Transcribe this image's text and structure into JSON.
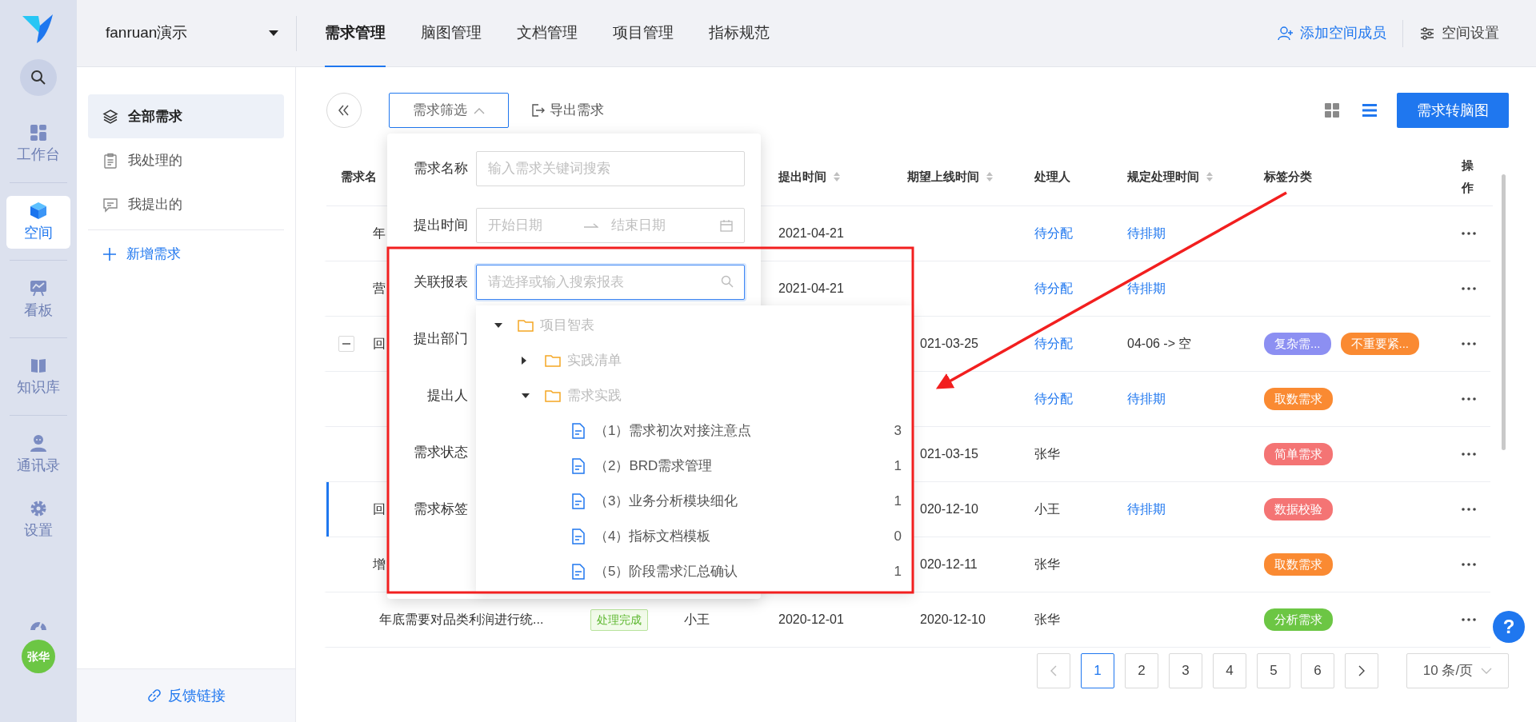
{
  "rail": {
    "groups": [
      [
        {
          "label": "工作台",
          "selected": false
        }
      ],
      [
        {
          "label": "空间",
          "selected": true
        }
      ],
      [
        {
          "label": "看板",
          "selected": false
        }
      ],
      [
        {
          "label": "知识库",
          "selected": false
        }
      ],
      [
        {
          "label": "通讯录",
          "selected": false
        },
        {
          "label": "设置",
          "selected": false
        }
      ]
    ],
    "avatar": "张华"
  },
  "workspace": {
    "name": "fanruan演示"
  },
  "tabs": [
    {
      "label": "需求管理",
      "selected": true
    },
    {
      "label": "脑图管理",
      "selected": false
    },
    {
      "label": "文档管理",
      "selected": false
    },
    {
      "label": "项目管理",
      "selected": false
    },
    {
      "label": "指标规范",
      "selected": false
    }
  ],
  "header_actions": [
    {
      "label": "添加空间成员",
      "primary": true
    },
    {
      "label": "空间设置",
      "primary": false
    }
  ],
  "nav": {
    "items": [
      {
        "label": "全部需求",
        "selected": true
      },
      {
        "label": "我处理的",
        "selected": false
      },
      {
        "label": "我提出的",
        "selected": false
      }
    ],
    "add": "新增需求",
    "feedback": "反馈链接"
  },
  "toolbar": {
    "filter": "需求筛选",
    "filter_open": true,
    "export": "导出需求",
    "views": [
      {
        "selected": false
      },
      {
        "selected": true
      }
    ],
    "primary": "需求转脑图"
  },
  "filter_panel": {
    "fields": [
      {
        "label": "需求名称",
        "kind": "text",
        "placeholder": "输入需求关键词搜索"
      },
      {
        "label": "提出时间",
        "kind": "daterange",
        "start_placeholder": "开始日期",
        "end_placeholder": "结束日期"
      },
      {
        "label": "关联报表",
        "kind": "search",
        "placeholder": "请选择或输入搜索报表",
        "focused": true
      },
      {
        "label": "提出部门",
        "kind": "covered"
      },
      {
        "label": "提出人",
        "kind": "covered"
      },
      {
        "label": "需求状态",
        "kind": "covered"
      },
      {
        "label": "需求标签",
        "kind": "covered"
      }
    ]
  },
  "report_tree": [
    {
      "label": "项目智表",
      "kind": "folder",
      "expanded": true,
      "children": [
        {
          "label": "实践清单",
          "kind": "folder",
          "expanded": false
        },
        {
          "label": "需求实践",
          "kind": "folder",
          "expanded": true,
          "children": [
            {
              "label": "（1）需求初次对接注意点",
              "kind": "file",
              "count": "3"
            },
            {
              "label": "（2）BRD需求管理",
              "kind": "file",
              "count": "1"
            },
            {
              "label": "（3）业务分析模块细化",
              "kind": "file",
              "count": "1"
            },
            {
              "label": "（4）指标文档模板",
              "kind": "file",
              "count": "0"
            },
            {
              "label": "（5）阶段需求汇总确认",
              "kind": "file",
              "count": "1"
            }
          ]
        }
      ]
    }
  ],
  "table": {
    "columns": [
      {
        "label": "需求名"
      },
      {},
      {},
      {
        "label": "提出时间",
        "sortable": true
      },
      {
        "label": "期望上线时间",
        "sortable": true
      },
      {
        "label": "处理人"
      },
      {
        "label": "规定处理时间",
        "sortable": true
      },
      {
        "label": "标签分类"
      },
      {
        "label": "操作"
      }
    ],
    "rows": [
      {
        "name": "年",
        "selected": false,
        "submitted": "2021-04-21",
        "handler": {
          "text": "待分配",
          "pending": true
        },
        "deadline": {
          "text": "待排期",
          "pending": true
        },
        "tags": []
      },
      {
        "name": "营",
        "selected": false,
        "submitted": "2021-04-21",
        "handler": {
          "text": "待分配",
          "pending": true
        },
        "deadline": {
          "text": "待排期",
          "pending": true
        },
        "tags": []
      },
      {
        "name": "回",
        "selected": false,
        "expanded": true,
        "expected": "021-03-25",
        "handler": {
          "text": "待分配",
          "pending": true
        },
        "deadline": {
          "text": "04-06 -> 空",
          "pending": false
        },
        "tags": [
          {
            "label": "复杂需...",
            "color": "#8c8ff2"
          },
          {
            "label": "不重要紧...",
            "color": "#fa8a32"
          }
        ]
      },
      {
        "selected": false,
        "handler": {
          "text": "待分配",
          "pending": true
        },
        "deadline": {
          "text": "待排期",
          "pending": true
        },
        "tags": [
          {
            "label": "取数需求",
            "color": "#fa8a32"
          }
        ]
      },
      {
        "selected": false,
        "expected": "021-03-15",
        "handler": {
          "text": "张华",
          "pending": false
        },
        "tags": [
          {
            "label": "简单需求",
            "color": "#f47474"
          }
        ]
      },
      {
        "name": "回",
        "selected": true,
        "expected": "020-12-10",
        "handler": {
          "text": "小王",
          "pending": false
        },
        "deadline": {
          "text": "待排期",
          "pending": true
        },
        "tags": [
          {
            "label": "数据校验",
            "color": "#f47474"
          }
        ]
      },
      {
        "name": "增",
        "selected": false,
        "expected": "020-12-11",
        "handler": {
          "text": "张华",
          "pending": false
        },
        "tags": [
          {
            "label": "取数需求",
            "color": "#fa8a32"
          }
        ]
      },
      {
        "name": "年底需要对品类利润进行统...",
        "selected": false,
        "status": "处理完成",
        "submitter": "小王",
        "submitted": "2020-12-01",
        "expected": "2020-12-10",
        "handler": {
          "text": "张华",
          "pending": false
        },
        "tags": [
          {
            "label": "分析需求",
            "color": "#6cc644"
          }
        ]
      }
    ]
  },
  "pagination": {
    "pages": [
      {
        "label": "1",
        "selected": true
      },
      {
        "label": "2",
        "selected": false
      },
      {
        "label": "3",
        "selected": false
      },
      {
        "label": "4",
        "selected": false
      },
      {
        "label": "5",
        "selected": false
      },
      {
        "label": "6",
        "selected": false
      }
    ],
    "page_size": "10 条/页"
  },
  "help": "?"
}
